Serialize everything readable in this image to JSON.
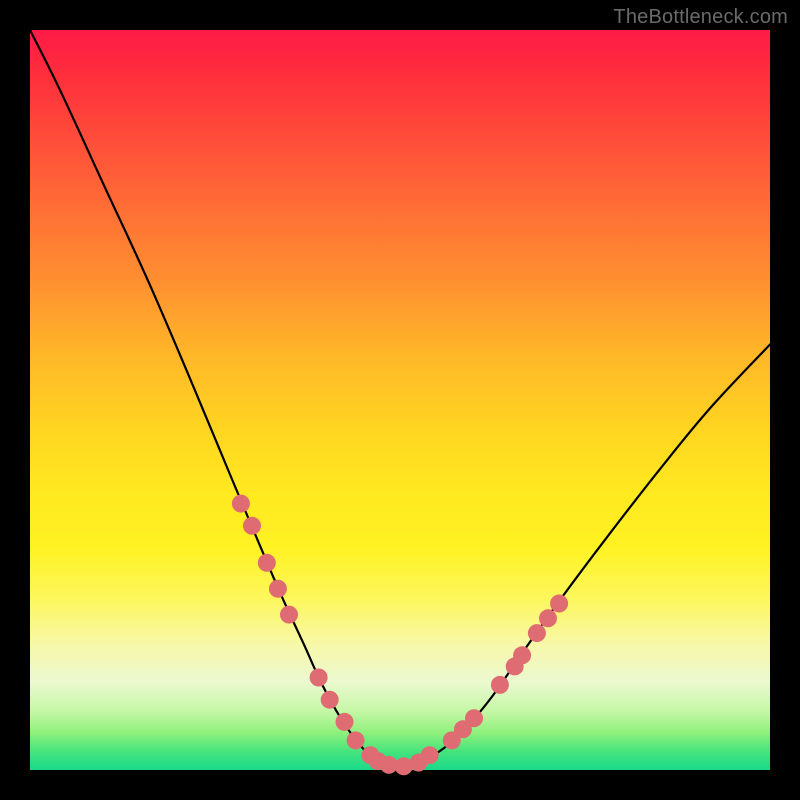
{
  "watermark": "TheBottleneck.com",
  "colors": {
    "curve_stroke": "#000000",
    "dot_fill": "#e06c73",
    "background_black": "#000000"
  },
  "chart_data": {
    "type": "line",
    "title": "",
    "xlabel": "",
    "ylabel": "",
    "xlim": [
      0,
      1
    ],
    "ylim": [
      0,
      1
    ],
    "note": "V-shaped bottleneck curve over rainbow background; no axis ticks or labels shown.",
    "series": [
      {
        "name": "bottleneck-curve",
        "x": [
          0.0,
          0.04,
          0.1,
          0.16,
          0.22,
          0.27,
          0.31,
          0.34,
          0.37,
          0.395,
          0.42,
          0.445,
          0.47,
          0.505,
          0.53,
          0.56,
          0.59,
          0.625,
          0.67,
          0.72,
          0.78,
          0.85,
          0.92,
          1.0
        ],
        "y": [
          1.0,
          0.92,
          0.79,
          0.66,
          0.52,
          0.4,
          0.305,
          0.235,
          0.17,
          0.115,
          0.07,
          0.035,
          0.012,
          0.005,
          0.012,
          0.03,
          0.058,
          0.1,
          0.165,
          0.235,
          0.315,
          0.405,
          0.49,
          0.575
        ]
      }
    ],
    "highlight_points": {
      "name": "markers",
      "points": [
        [
          0.285,
          0.36
        ],
        [
          0.3,
          0.33
        ],
        [
          0.32,
          0.28
        ],
        [
          0.335,
          0.245
        ],
        [
          0.35,
          0.21
        ],
        [
          0.39,
          0.125
        ],
        [
          0.405,
          0.095
        ],
        [
          0.425,
          0.065
        ],
        [
          0.44,
          0.04
        ],
        [
          0.46,
          0.02
        ],
        [
          0.47,
          0.012
        ],
        [
          0.485,
          0.007
        ],
        [
          0.505,
          0.005
        ],
        [
          0.525,
          0.01
        ],
        [
          0.54,
          0.02
        ],
        [
          0.57,
          0.04
        ],
        [
          0.585,
          0.055
        ],
        [
          0.6,
          0.07
        ],
        [
          0.635,
          0.115
        ],
        [
          0.655,
          0.14
        ],
        [
          0.665,
          0.155
        ],
        [
          0.685,
          0.185
        ],
        [
          0.7,
          0.205
        ],
        [
          0.715,
          0.225
        ]
      ]
    }
  }
}
